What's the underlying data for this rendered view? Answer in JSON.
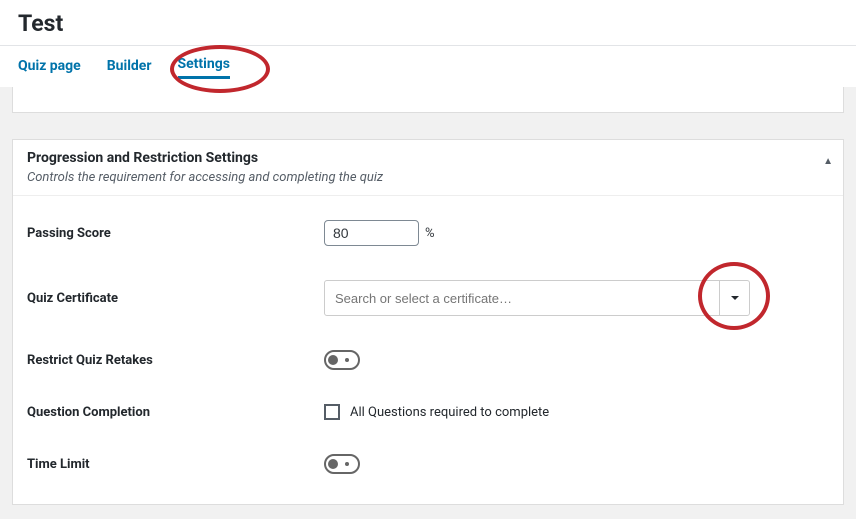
{
  "page": {
    "title": "Test"
  },
  "tabs": {
    "quiz_page": "Quiz page",
    "builder": "Builder",
    "settings": "Settings"
  },
  "panel": {
    "title": "Progression and Restriction Settings",
    "desc": "Controls the requirement for accessing and completing the quiz"
  },
  "fields": {
    "passing_score": {
      "label": "Passing Score",
      "value": "80",
      "suffix": "%"
    },
    "quiz_certificate": {
      "label": "Quiz Certificate",
      "placeholder": "Search or select a certificate…"
    },
    "restrict_retakes": {
      "label": "Restrict Quiz Retakes"
    },
    "question_completion": {
      "label": "Question Completion",
      "checkbox_label": "All Questions required to complete"
    },
    "time_limit": {
      "label": "Time Limit"
    }
  }
}
